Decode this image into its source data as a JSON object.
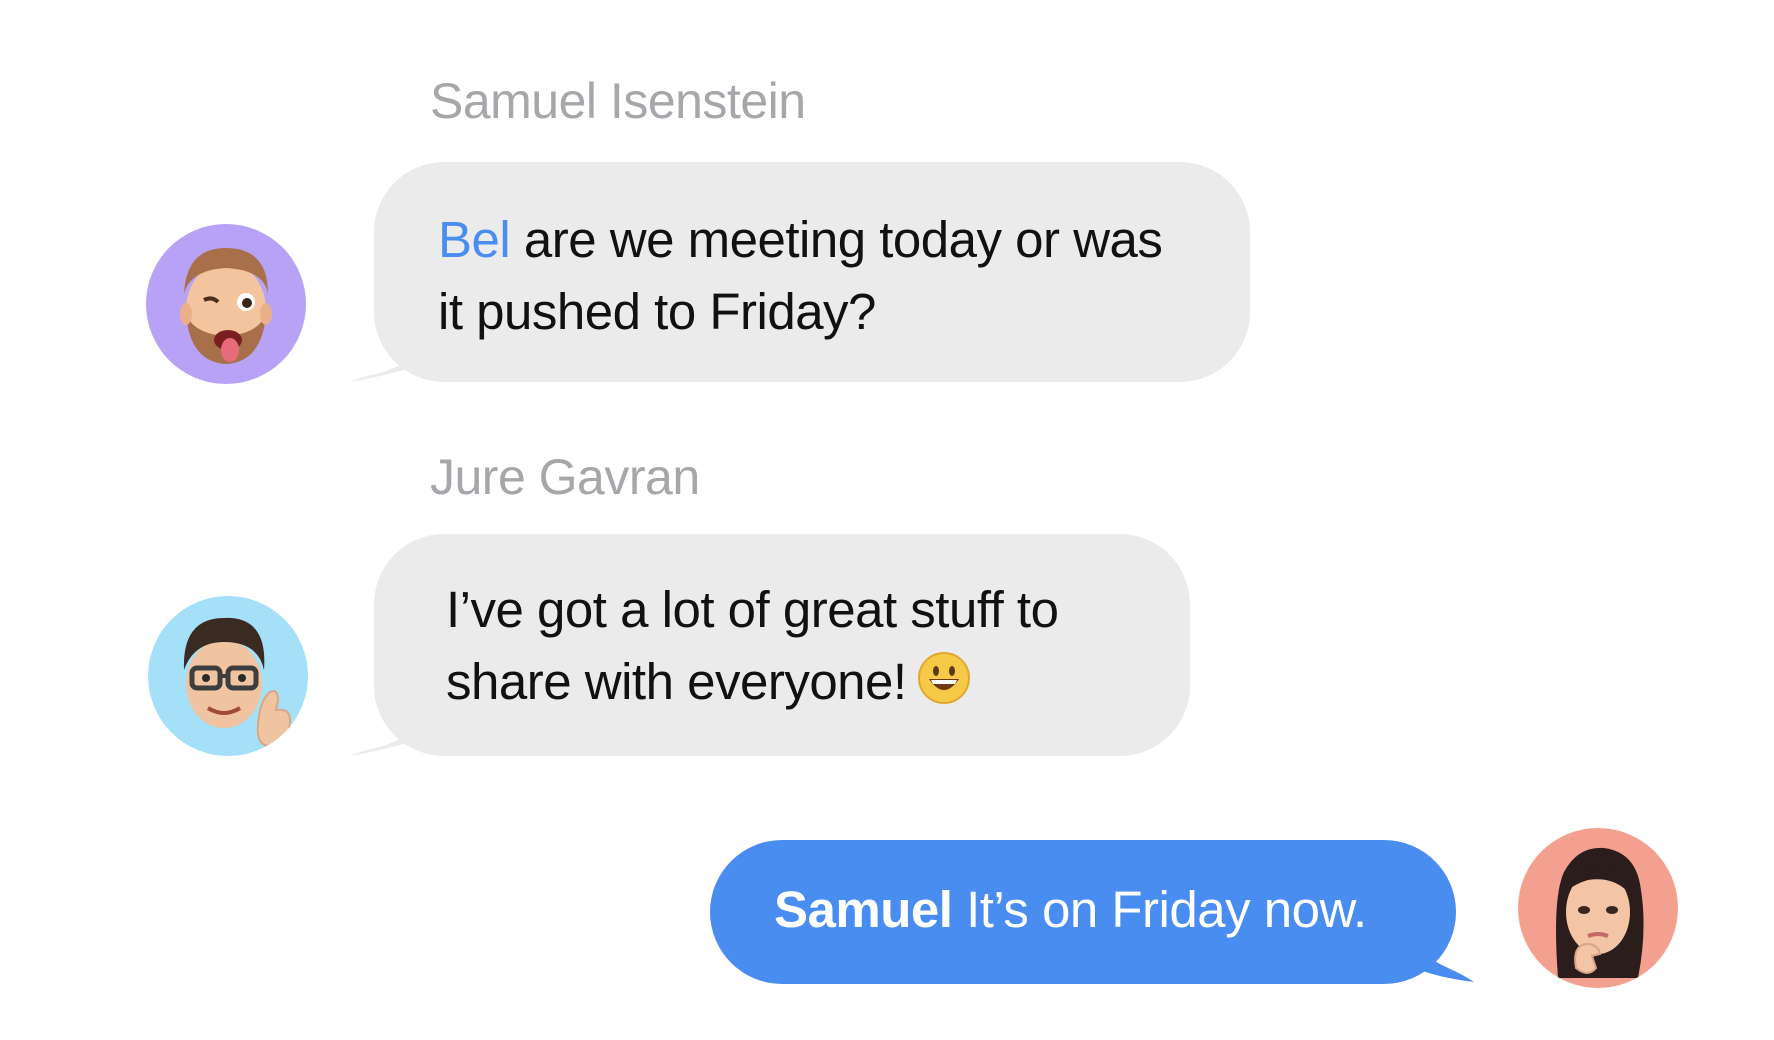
{
  "messages": [
    {
      "sender": "Samuel Isenstein",
      "direction": "incoming",
      "mention": "Bel",
      "text_line1": "are we meeting today or was",
      "text_line2": "it pushed to Friday?",
      "avatar": {
        "icon": "winking-bearded-man-memoji",
        "bg_color": "#b8a2f5"
      }
    },
    {
      "sender": "Jure Gavran",
      "direction": "incoming",
      "text_line1": "I’ve got a lot of great stuff to",
      "text_line2": "share with everyone!",
      "emoji": "grinning-face-icon",
      "avatar": {
        "icon": "glasses-thumbs-up-man-memoji",
        "bg_color": "#a4e0f7"
      }
    },
    {
      "direction": "outgoing",
      "mention": "Samuel",
      "text": "It’s on Friday now.",
      "avatar": {
        "icon": "thinking-woman-memoji",
        "bg_color": "#f4a090"
      }
    }
  ],
  "colors": {
    "incoming_bubble": "#ebebeb",
    "outgoing_bubble": "#4a8df0",
    "mention": "#4a8df0",
    "sender_name": "#a7a7ab"
  }
}
